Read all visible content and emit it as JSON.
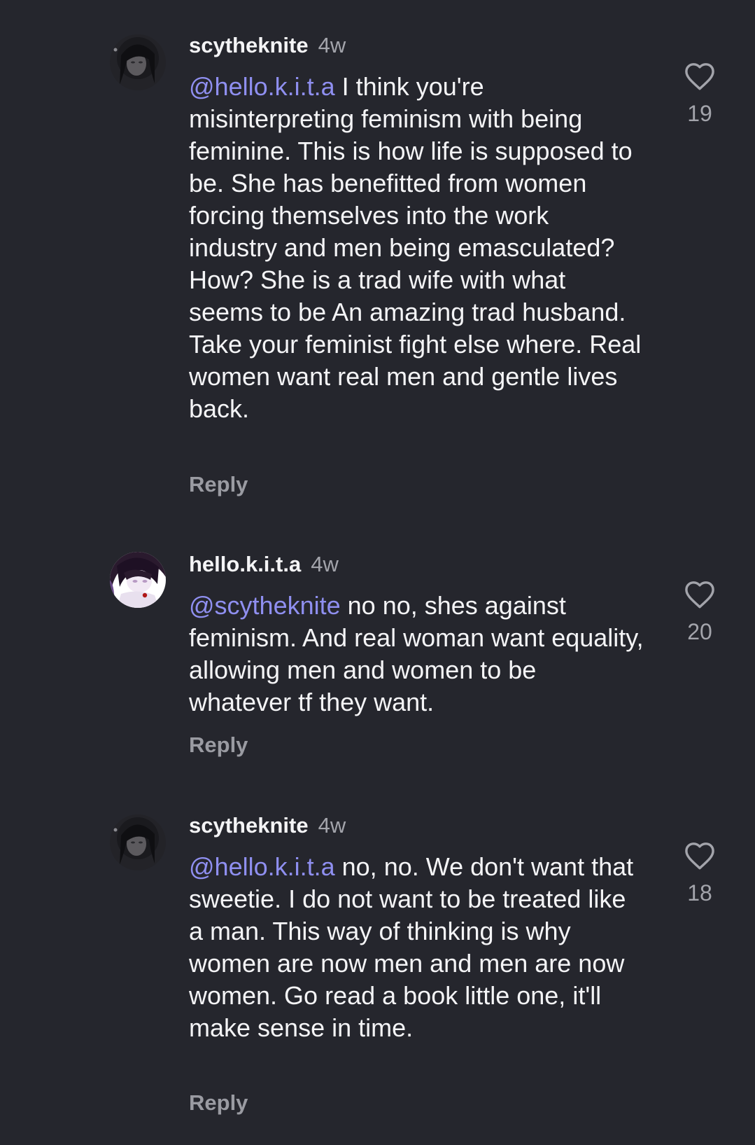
{
  "comments": [
    {
      "username": "scytheknite",
      "time": "4w",
      "mention": "@hello.k.i.t.a",
      "text": " I think you're misinterpreting feminism with being feminine. This is how life is supposed to be. She has benefitted from women forcing themselves into the work industry and men being emasculated? How? She is a trad wife with what seems to be An amazing trad husband. Take your feminist fight else where. Real women want real men and gentle lives back.",
      "reply_label": "Reply",
      "likes": "19",
      "avatar_icon": "avatar-dark-portrait-icon"
    },
    {
      "username": "hello.k.i.t.a",
      "time": "4w",
      "mention": "@scytheknite",
      "text": " no no, shes against feminism. And real woman want equality, allowing men and women to be whatever tf they want.",
      "reply_label": "Reply",
      "likes": "20",
      "avatar_icon": "avatar-anime-girl-icon"
    },
    {
      "username": "scytheknite",
      "time": "4w",
      "mention": "@hello.k.i.t.a",
      "text": " no, no. We don't want that sweetie. I do not want to be treated like a man. This way of thinking is why women are now men and men are now women. Go read a book little one, it'll make sense in time.",
      "reply_label": "Reply",
      "likes": "18",
      "avatar_icon": "avatar-dark-portrait-icon"
    }
  ],
  "colors": {
    "background": "#25262d",
    "mention": "#8f8ff0",
    "secondary_text": "#a3a4ab"
  }
}
